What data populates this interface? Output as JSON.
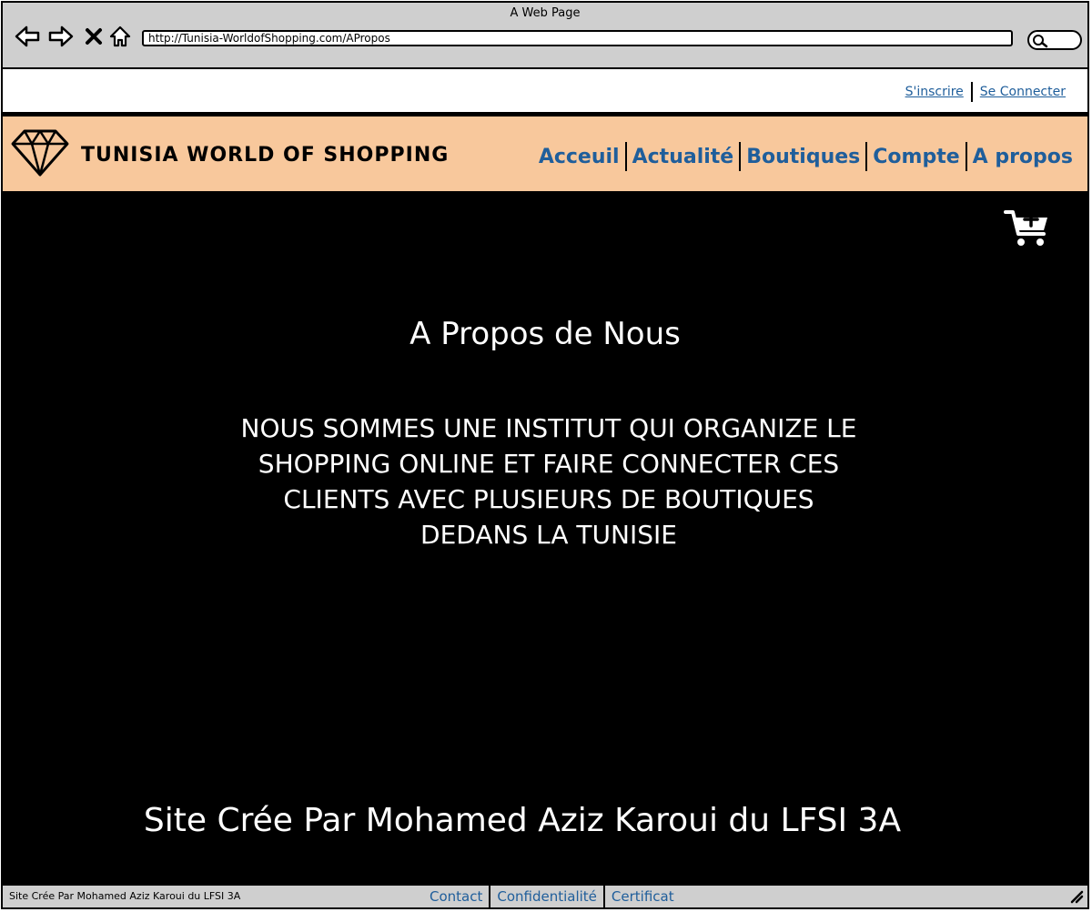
{
  "browser": {
    "title": "A Web Page",
    "url": "http://Tunisia-WorldofShopping.com/APropos"
  },
  "auth": {
    "signup": "S'inscrire",
    "login": "Se Connecter"
  },
  "header": {
    "brand": "TUNISIA WORLD OF SHOPPING",
    "nav": [
      "Acceuil",
      "Actualité",
      "Boutiques",
      "Compte",
      "A propos"
    ]
  },
  "main": {
    "title": "A Propos de Nous",
    "body": "NOUS SOMMES UNE INSTITUT QUI ORGANIZE LE SHOPPING ONLINE ET FAIRE CONNECTER CES CLIENTS AVEC PLUSIEURS DE BOUTIQUES DEDANS LA TUNISIE",
    "credit": "Site Crée Par Mohamed Aziz Karoui du LFSI 3A"
  },
  "footer": {
    "status": "Site Crée Par Mohamed Aziz Karoui du LFSI 3A",
    "links": [
      "Contact",
      "Confidentialité",
      "Certificat"
    ]
  },
  "colors": {
    "header_bg": "#f8c89c",
    "link": "#1f5e9b",
    "page_bg": "#000000"
  }
}
